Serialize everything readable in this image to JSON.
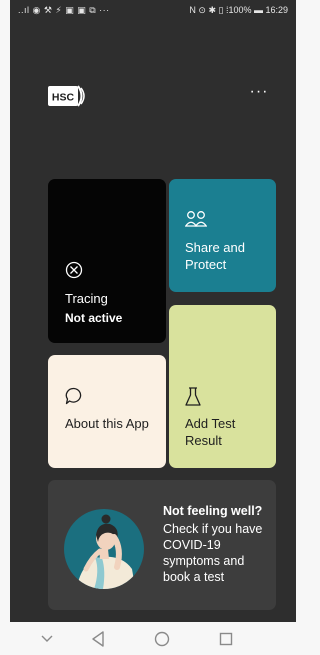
{
  "status_bar": {
    "left_icons": "..ıl ◉ ⚒ ⚡ ▣ ▣ ⧉ ···",
    "right": "N ⊙ ✱ ▯ ⁞100%  ▬ 16:29"
  },
  "header": {
    "logo_text": "HSC",
    "menu_label": "···"
  },
  "tiles": {
    "tracing": {
      "label": "Tracing",
      "status": "Not active",
      "icon": "tracing-off-icon"
    },
    "share": {
      "label": "Share and Protect",
      "icon": "people-icon"
    },
    "about": {
      "label": "About this App",
      "icon": "speech-bubble-icon"
    },
    "test": {
      "label": "Add Test Result",
      "icon": "flask-icon"
    }
  },
  "banner": {
    "title": "Not feeling well?",
    "body": "Check if you have COVID-19 symptoms and book a test"
  },
  "colors": {
    "background": "#2e2e2e",
    "tracing_tile": "#050505",
    "share_tile": "#1b7f91",
    "about_tile": "#fbf1e4",
    "test_tile": "#d9e29d",
    "banner": "#3d3d3d"
  },
  "navbar": {
    "icons": [
      "back-icon",
      "home-icon",
      "recents-icon"
    ]
  }
}
